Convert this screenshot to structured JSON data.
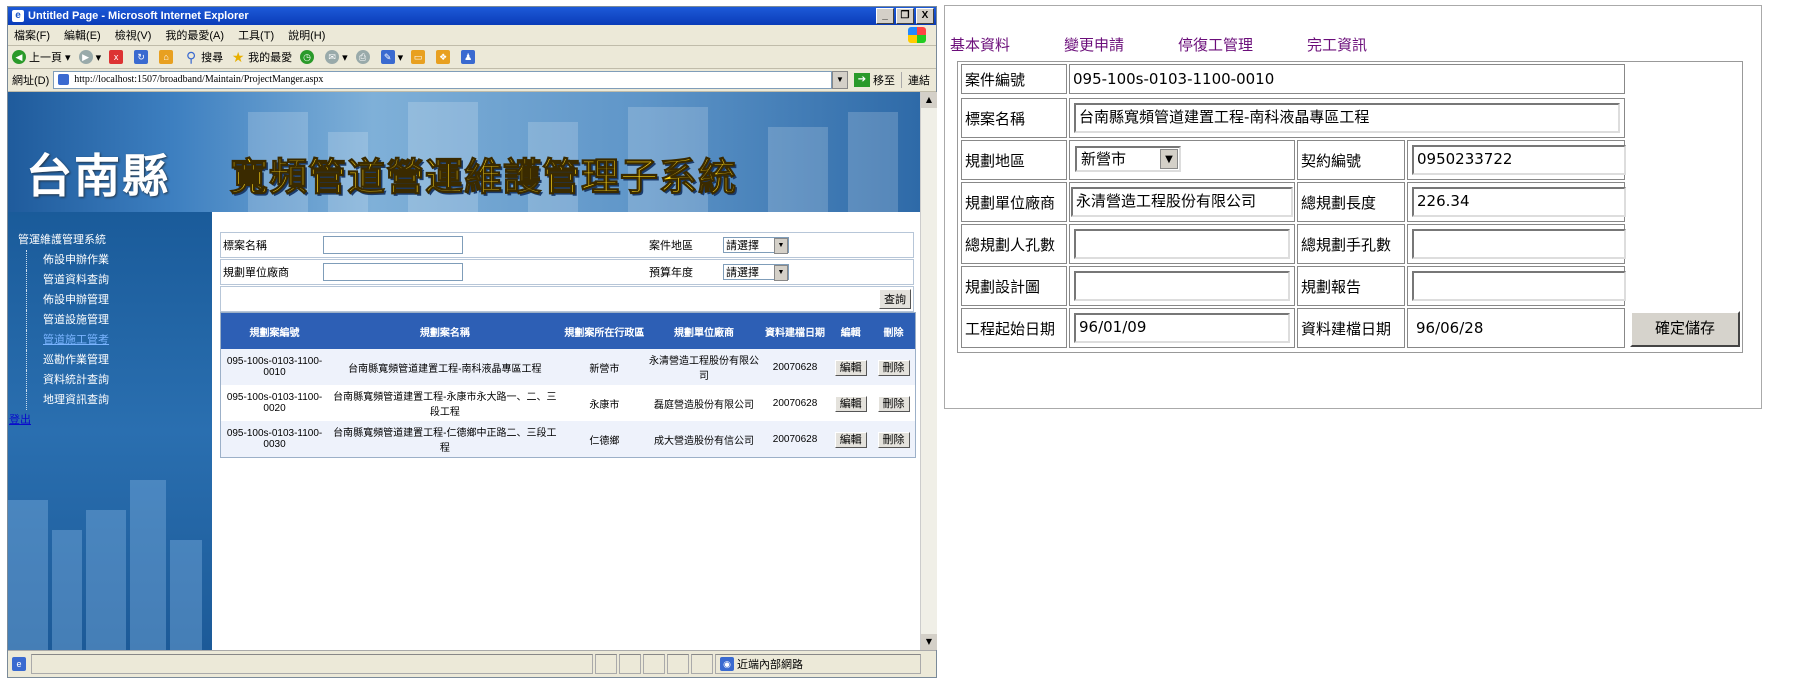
{
  "browser": {
    "title": "Untitled Page - Microsoft Internet Explorer",
    "menu": [
      "檔案(F)",
      "編輯(E)",
      "檢視(V)",
      "我的最愛(A)",
      "工具(T)",
      "說明(H)"
    ],
    "toolbar": {
      "back": "上一頁",
      "search": "搜尋",
      "favorites": "我的最愛"
    },
    "address_label": "網址(D)",
    "address_value": "http://localhost:1507/broadband/Maintain/ProjectManger.aspx",
    "go_label": "移至",
    "links_label": "連結",
    "status_zone": "近端內部網路",
    "window_buttons": {
      "minimize": "_",
      "restore": "❐",
      "close": "X"
    }
  },
  "banner": {
    "county": "台南縣",
    "system_title": "寬頻管道營運維護管理子系統"
  },
  "sidebar": {
    "root": "管運維護管理系統",
    "items": [
      "佈設申辦作業",
      "管道資料查詢",
      "佈設申辦管理",
      "管道設施管理",
      "管道施工管考",
      "巡勘作業管理",
      "資料統計查詢",
      "地理資訊查詢"
    ],
    "active_index": 4,
    "logout": "登出"
  },
  "search": {
    "case_name_label": "標案名稱",
    "case_name_value": "",
    "unit_label": "規劃單位廠商",
    "unit_value": "",
    "area_label": "案件地區",
    "area_value": "請選擇",
    "budget_year_label": "預算年度",
    "budget_year_value": "請選擇",
    "query_button": "查詢"
  },
  "grid": {
    "headers": [
      "規劃案編號",
      "規劃案名稱",
      "規劃案所在行政區",
      "規劃單位廠商",
      "資料建檔日期",
      "編輯",
      "刪除"
    ],
    "rows": [
      {
        "id": "095-100s-0103-1100-0010",
        "name": "台南縣寬頻管道建置工程-南科液晶專區工程",
        "district": "新營市",
        "vendor": "永清營造工程股份有限公司",
        "date": "20070628",
        "edit": "編輯",
        "delete": "刪除"
      },
      {
        "id": "095-100s-0103-1100-0020",
        "name": "台南縣寬頻管道建置工程-永康市永大路一、二、三段工程",
        "district": "永康市",
        "vendor": "磊庭營造股份有限公司",
        "date": "20070628",
        "edit": "編輯",
        "delete": "刪除"
      },
      {
        "id": "095-100s-0103-1100-0030",
        "name": "台南縣寬頻管道建置工程-仁德鄉中正路二、三段工程",
        "district": "仁德鄉",
        "vendor": "成大營造股份有信公司",
        "date": "20070628",
        "edit": "編輯",
        "delete": "刪除"
      }
    ]
  },
  "detail": {
    "tabs": [
      "基本資料",
      "變更申請",
      "停復工管理",
      "完工資訊"
    ],
    "case_no_label": "案件編號",
    "case_no_value": "095-100s-0103-1100-0010",
    "case_name_label": "標案名稱",
    "case_name_value": "台南縣寬頻管道建置工程-南科液晶專區工程",
    "area_label": "規劃地區",
    "area_value": "新營市",
    "contract_label": "契約編號",
    "contract_value": "0950233722",
    "vendor_label": "規劃單位廠商",
    "vendor_value": "永清營造工程股份有限公司",
    "total_length_label": "總規劃長度",
    "total_length_value": "226.34",
    "person_holes_label": "總規劃人孔數",
    "person_holes_value": "",
    "hand_holes_label": "總規劃手孔數",
    "hand_holes_value": "",
    "design_drawing_label": "規劃設計圖",
    "design_drawing_value": "",
    "report_label": "規劃報告",
    "report_value": "",
    "start_date_label": "工程起始日期",
    "start_date_value": "96/01/09",
    "created_date_label": "資料建檔日期",
    "created_date_value": "96/06/28",
    "save_button": "確定儲存"
  }
}
